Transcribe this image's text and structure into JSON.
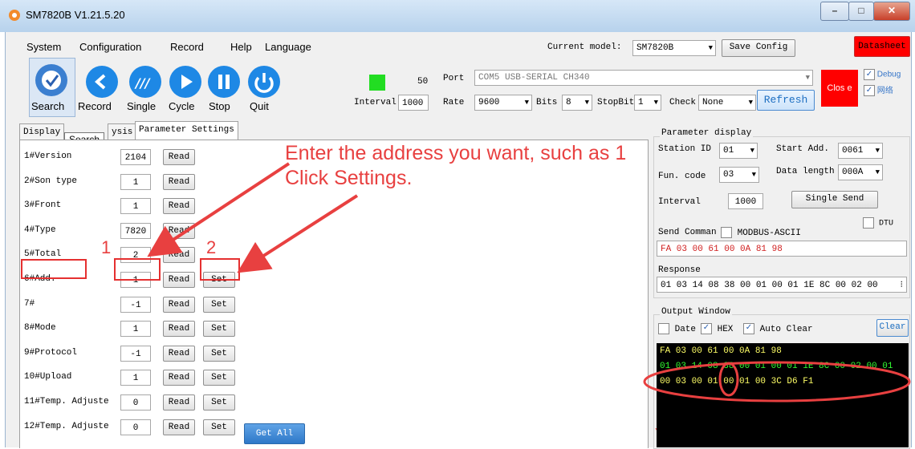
{
  "window": {
    "title": "SM7820B  V1.21.5.20"
  },
  "menu": [
    "System",
    "Configuration",
    "Record",
    "Help",
    "Language"
  ],
  "toolbar": {
    "search": "Search",
    "record": "Record",
    "single": "Single",
    "cycle": "Cycle",
    "stop": "Stop",
    "quit": "Quit"
  },
  "current_model": {
    "label": "Current model:",
    "value": "SM7820B",
    "save_label": "Save Config",
    "datasheet_label": "Datasheet"
  },
  "connection": {
    "interval_label": "Interval",
    "interval_value": "1000",
    "count": "50",
    "port_label": "Port",
    "port_value": "COM5 USB-SERIAL CH340",
    "rate_label": "Rate",
    "rate_value": "9600",
    "bits_label": "Bits",
    "bits_value": "8",
    "stopbit_label": "StopBit",
    "stopbit_value": "1",
    "check_label": "Check",
    "check_value": "None",
    "refresh_label": "Refresh",
    "close_label": "Clos e",
    "debug_label": "Debug",
    "network_label": "网络"
  },
  "tabs": {
    "display": "Display",
    "analysis": "ysis",
    "params": "Parameter Settings",
    "tooltip": "Search"
  },
  "params": {
    "read_label": "Read",
    "set_label": "Set",
    "get_all_label": "Get All",
    "rows": [
      {
        "label": "1#Version",
        "value": "2104"
      },
      {
        "label": "2#Son type",
        "value": "1"
      },
      {
        "label": "3#Front",
        "value": "1"
      },
      {
        "label": "4#Type",
        "value": "7820"
      },
      {
        "label": "5#Total",
        "value": "2"
      },
      {
        "label": "6#Add.",
        "value": "1"
      },
      {
        "label": "7#",
        "value": "-1"
      },
      {
        "label": "8#Mode",
        "value": "1"
      },
      {
        "label": "9#Protocol",
        "value": "-1"
      },
      {
        "label": "10#Upload",
        "value": "1"
      },
      {
        "label": "11#Temp. Adjuste",
        "value": "0"
      },
      {
        "label": "12#Temp. Adjuste",
        "value": "0"
      }
    ]
  },
  "annotation": {
    "text": "Enter the address you want, such as 1 Click Settings.",
    "step1": "1",
    "step2": "2"
  },
  "param_display": {
    "title": "Parameter display",
    "station_label": "Station ID",
    "station_value": "01",
    "start_label": "Start Add.",
    "start_value": "0061",
    "func_label": "Fun. code",
    "func_value": "03",
    "datalen_label": "Data length",
    "datalen_value": "000A",
    "interval_label": "Interval",
    "interval_value": "1000",
    "single_send_label": "Single Send",
    "dtu_label": "DTU",
    "send_label": "Send Comman",
    "ascii_label": "MODBUS-ASCII",
    "send_value": "FA 03 00 61 00 0A 81 98",
    "response_label": "Response",
    "response_value": "01 03 14 08 38 00 01 00 01 1E 8C 00 02 00"
  },
  "output": {
    "title": "Output Window",
    "date_label": "Date",
    "hex_label": "HEX",
    "autoclear_label": "Auto Clear",
    "clear_label": "Clear",
    "line1": "FA 03 00 61 00 0A 81 98",
    "line2": "01 03 14 08 38 00 01 00 01 1E 8C 00 02 00 01",
    "line3": "00 03 00 01 00 01 00 3C D6 F1"
  },
  "colors": {
    "status_green": "#22dd22",
    "close_red": "#ff0000",
    "annotation_red": "#e84040",
    "output_bg": "#000000",
    "output_yellow": "#ffff66",
    "output_green": "#33ff33"
  }
}
